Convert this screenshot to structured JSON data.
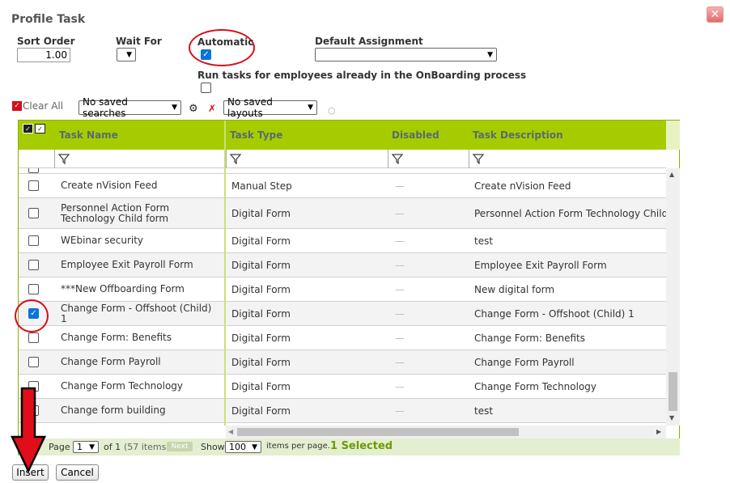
{
  "dialog": {
    "title": "Profile Task",
    "close_icon": "close-icon"
  },
  "form": {
    "sort_order_label": "Sort Order",
    "sort_order_value": "1.00",
    "wait_for_label": "Wait For",
    "automatic_label": "Automatic",
    "automatic_checked": true,
    "default_assignment_label": "Default Assignment",
    "default_assignment_value": "",
    "run_tasks_label": "Run tasks for employees already in the OnBoarding process",
    "run_tasks_checked": false
  },
  "toolbar": {
    "clear_all_label": "Clear All",
    "saved_searches_value": "No saved searches",
    "saved_layouts_value": "No saved layouts",
    "icons": [
      "binoculars-icon",
      "clear-search-icon",
      "save-layout-icon"
    ]
  },
  "grid": {
    "columns": [
      "Task Name",
      "Task Type",
      "Disabled",
      "Task Description"
    ],
    "rows": [
      {
        "checked": false,
        "name": "Create nVision Feed",
        "type": "Manual Step",
        "disabled": "—",
        "description": "Create nVision Feed"
      },
      {
        "checked": false,
        "name": "Personnel Action Form Technology Child form",
        "type": "Digital Form",
        "disabled": "—",
        "description": "Personnel Action Form Technology Child fo"
      },
      {
        "checked": false,
        "name": "WEbinar security",
        "type": "Digital Form",
        "disabled": "—",
        "description": "test"
      },
      {
        "checked": false,
        "name": "Employee Exit Payroll Form",
        "type": "Digital Form",
        "disabled": "—",
        "description": "Employee Exit Payroll Form"
      },
      {
        "checked": false,
        "name": "***New Offboarding Form",
        "type": "Digital Form",
        "disabled": "—",
        "description": "New digital form"
      },
      {
        "checked": true,
        "name": "Change Form - Offshoot (Child) 1",
        "type": "Digital Form",
        "disabled": "—",
        "description": "Change Form - Offshoot (Child) 1"
      },
      {
        "checked": false,
        "name": "Change Form: Benefits",
        "type": "Digital Form",
        "disabled": "—",
        "description": "Change Form: Benefits"
      },
      {
        "checked": false,
        "name": "Change Form Payroll",
        "type": "Digital Form",
        "disabled": "—",
        "description": "Change Form Payroll"
      },
      {
        "checked": false,
        "name": "Change Form Technology",
        "type": "Digital Form",
        "disabled": "—",
        "description": "Change Form Technology"
      },
      {
        "checked": false,
        "name": "Change form building",
        "type": "Digital Form",
        "disabled": "—",
        "description": "test"
      }
    ]
  },
  "pager": {
    "page_label": "Page",
    "page_value": "1",
    "of_label": "of 1",
    "items_count": "(57 items)",
    "next_label": "Next",
    "show_label": "Show",
    "per_page_value": "100",
    "per_page_suffix": "items per page.",
    "selected_text": "1 Selected"
  },
  "actions": {
    "insert_label": "Insert",
    "cancel_label": "Cancel"
  },
  "colors": {
    "accent": "#a6cc00",
    "annotation_red": "#d40e1b",
    "checkbox_blue": "#0b73d9"
  }
}
